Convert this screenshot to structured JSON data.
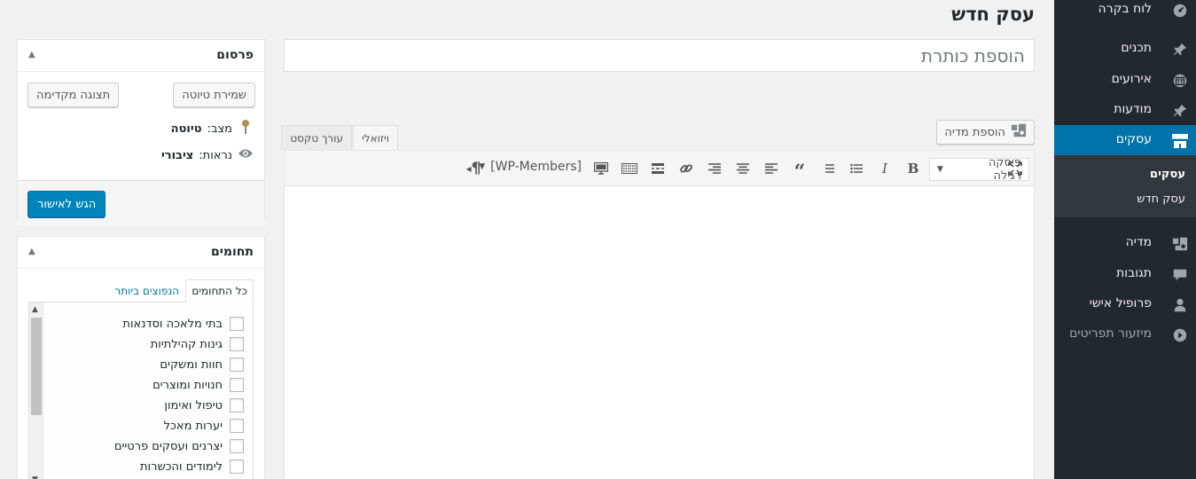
{
  "page": {
    "title": "עסק חדש"
  },
  "sidebar": {
    "items": [
      {
        "label": "לוח בקרה",
        "icon": "dashboard-icon"
      },
      {
        "label": "תכנים",
        "icon": "pin-icon"
      },
      {
        "label": "אירועים",
        "icon": "calendar-icon"
      },
      {
        "label": "מודעות",
        "icon": "pin-icon"
      },
      {
        "label": "עסקים",
        "icon": "store-icon"
      },
      {
        "label": "מדיה",
        "icon": "media-icon"
      },
      {
        "label": "תגובות",
        "icon": "comment-icon"
      },
      {
        "label": "פרופיל אישי",
        "icon": "user-icon"
      },
      {
        "label": "מיזעור תפריטים",
        "icon": "collapse-icon"
      }
    ],
    "submenu": [
      {
        "label": "עסקים"
      },
      {
        "label": "עסק חדש"
      }
    ]
  },
  "editor": {
    "title_placeholder": "הוספת כותרת",
    "add_media_label": "הוספת מדיה",
    "tabs": [
      {
        "label": "ויזואלי"
      },
      {
        "label": "עורך טקסט"
      }
    ],
    "format_select": "פיסקה רגילה",
    "members_dropdown": "[WP-Members]"
  },
  "publish": {
    "title": "פרסום",
    "save_draft": "שמירת טיוטה",
    "preview": "תצוגה מקדימה",
    "status_label": "מצב:",
    "status_value": "טיוטה",
    "visibility_label": "נראות:",
    "visibility_value": "ציבורי",
    "submit": "הגש לאישור"
  },
  "categories": {
    "title": "תחומים",
    "tabs": [
      {
        "label": "כל התחומים"
      },
      {
        "label": "הנפוצים ביותר"
      }
    ],
    "items": [
      "בתי מלאכה וסדנאות",
      "גינות קהילתיות",
      "חוות ומשקים",
      "חנויות ומוצרים",
      "טיפול ואימון",
      "יערות מאכל",
      "יצרנים ועסקים פרטיים",
      "לימודים והכשרות"
    ]
  },
  "colors": {
    "sidebar_bg": "#23282d",
    "accent": "#0073aa",
    "primary_button": "#0085ba"
  }
}
